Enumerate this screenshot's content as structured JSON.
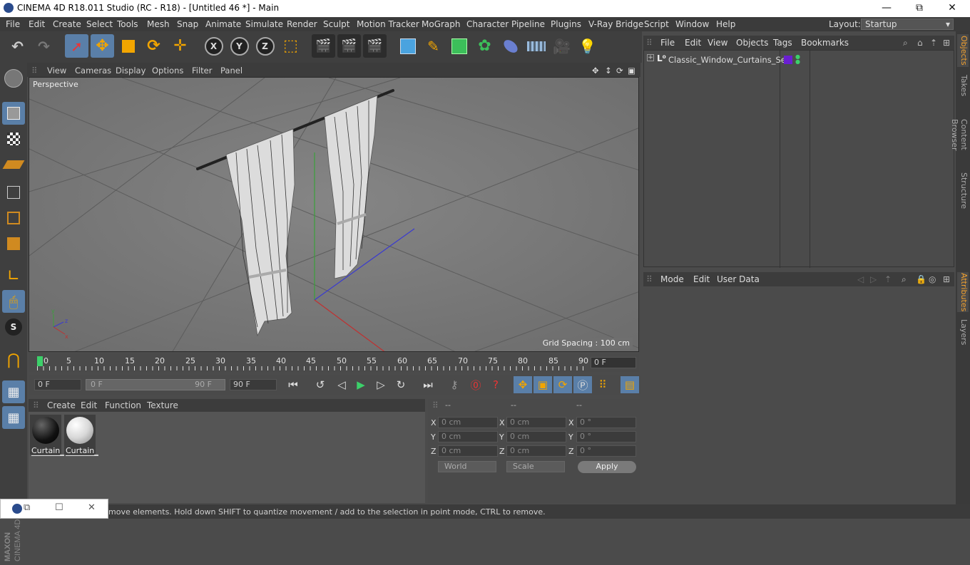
{
  "window": {
    "title": "CINEMA 4D R18.011 Studio (RC - R18) - [Untitled 46 *] - Main",
    "minimize": "—",
    "maximize": "⧉",
    "close": "✕"
  },
  "menubar": {
    "items": [
      "File",
      "Edit",
      "Create",
      "Select",
      "Tools",
      "Mesh",
      "Snap",
      "Animate",
      "Simulate",
      "Render",
      "Sculpt",
      "Motion Tracker",
      "MoGraph",
      "Character",
      "Pipeline",
      "Plugins",
      "V-Ray Bridge",
      "Script",
      "Window",
      "Help"
    ],
    "layout_label": "Layout:",
    "layout_value": "Startup"
  },
  "toolbar": {
    "axis_x": "X",
    "axis_y": "Y",
    "axis_z": "Z"
  },
  "viewport": {
    "menu": [
      "View",
      "Cameras",
      "Display",
      "Options",
      "Filter",
      "Panel"
    ],
    "camera_label": "Perspective",
    "grid_spacing": "Grid Spacing : 100 cm"
  },
  "timeline": {
    "ticks": [
      "0",
      "5",
      "10",
      "15",
      "20",
      "25",
      "30",
      "35",
      "40",
      "45",
      "50",
      "55",
      "60",
      "65",
      "70",
      "75",
      "80",
      "85",
      "90"
    ],
    "current_frame": "0 F"
  },
  "transport": {
    "start_field": "0 F",
    "range_start": "0 F",
    "range_end": "90 F",
    "end_field": "90 F"
  },
  "materials": {
    "menu": [
      "Create",
      "Edit",
      "Function",
      "Texture"
    ],
    "items": [
      {
        "label": "Curtain_",
        "color": "#111111"
      },
      {
        "label": "Curtain_",
        "color": "#d8d8d8"
      }
    ]
  },
  "coordinates": {
    "headers": [
      "--",
      "--",
      "--"
    ],
    "rows": [
      {
        "axis": "X",
        "pos": "0 cm",
        "size": "0 cm",
        "rot_axis": "X",
        "rot": "0 °"
      },
      {
        "axis": "Y",
        "pos": "0 cm",
        "size": "0 cm",
        "rot_axis": "Y",
        "rot": "0 °"
      },
      {
        "axis": "Z",
        "pos": "0 cm",
        "size": "0 cm",
        "rot_axis": "Z",
        "rot": "0 °"
      }
    ],
    "mode_select": "World",
    "scale_select": "Scale",
    "apply_label": "Apply"
  },
  "object_manager": {
    "menu": [
      "File",
      "Edit",
      "View",
      "Objects",
      "Tags",
      "Bookmarks"
    ],
    "object_name": "Classic_Window_Curtains_Set",
    "tag_color": "#6a1fd0"
  },
  "attributes": {
    "menu": [
      "Mode",
      "Edit",
      "User Data"
    ]
  },
  "side_tabs": [
    "Objects",
    "Takes",
    "Content Browser",
    "Structure",
    "Attributes",
    "Layers"
  ],
  "status": {
    "text": "move elements. Hold down SHIFT to quantize movement / add to the selection in point mode, CTRL to remove."
  },
  "branding": {
    "logo_text": "MAXON CINEMA 4D"
  }
}
